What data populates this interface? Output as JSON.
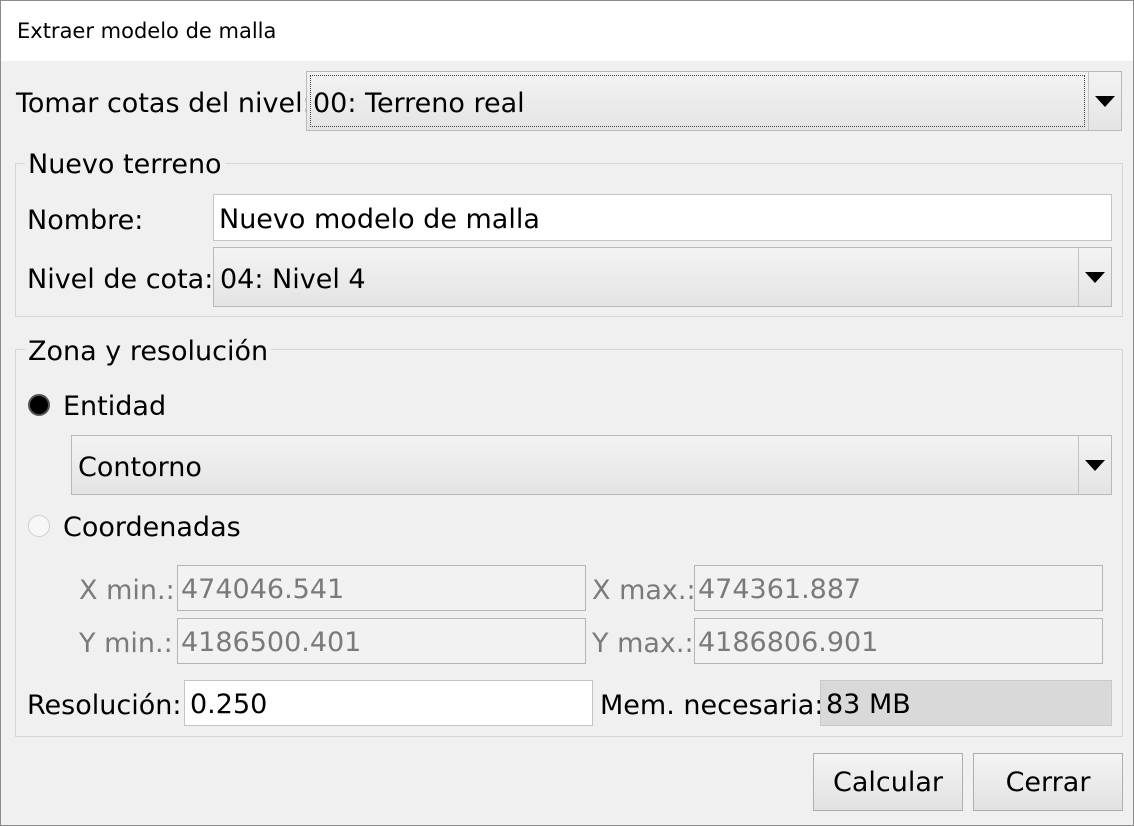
{
  "window": {
    "title": "Extraer modelo de malla"
  },
  "level_source": {
    "label": "Tomar cotas del nivel:",
    "value": "00: Terreno real"
  },
  "new_terrain": {
    "title": "Nuevo terreno",
    "name_label": "Nombre:",
    "name_value": "Nuevo modelo de malla",
    "level_label": "Nivel de cota:",
    "level_value": "04: Nivel 4"
  },
  "zone": {
    "title": "Zona y resolución",
    "entity_label": "Entidad",
    "entity_selected": true,
    "entity_value": "Contorno",
    "coords_label": "Coordenadas",
    "coords_selected": false,
    "x_min_label": "X min.:",
    "x_min_value": "474046.541",
    "x_max_label": "X max.:",
    "x_max_value": "474361.887",
    "y_min_label": "Y min.:",
    "y_min_value": "4186500.401",
    "y_max_label": "Y max.:",
    "y_max_value": "4186806.901",
    "resolution_label": "Resolución:",
    "resolution_value": "0.250",
    "memory_label": "Mem. necesaria:",
    "memory_value": "83 MB"
  },
  "buttons": {
    "calculate": "Calcular",
    "close": "Cerrar"
  },
  "icons": {
    "dropdown": "chevron-down-icon",
    "radio_on": "radio-selected-icon",
    "radio_off": "radio-unselected-icon"
  }
}
